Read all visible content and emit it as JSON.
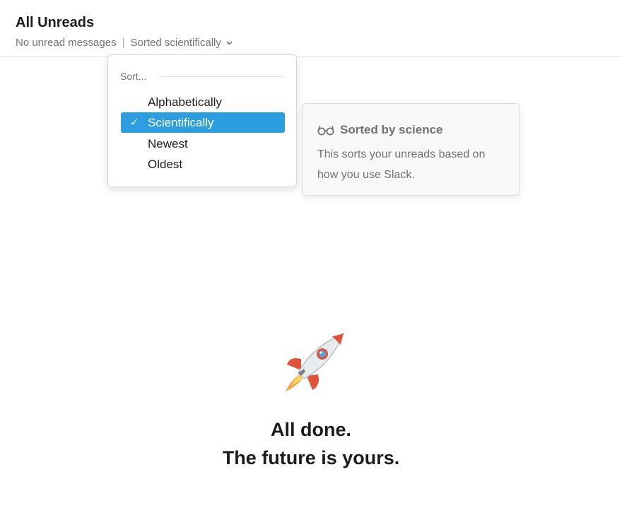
{
  "header": {
    "title": "All Unreads",
    "status": "No unread messages",
    "separator": "|",
    "sort_label": "Sorted scientifically",
    "sort_icon": "chevron-down-icon"
  },
  "sort_menu": {
    "header": "Sort...",
    "items": [
      {
        "label": "Alphabetically",
        "selected": false
      },
      {
        "label": "Scientifically",
        "selected": true,
        "check": "✓"
      },
      {
        "label": "Newest",
        "selected": false
      },
      {
        "label": "Oldest",
        "selected": false
      }
    ],
    "selected_color": "#2c9dde"
  },
  "tooltip": {
    "icon": "glasses-icon",
    "title": "Sorted by science",
    "body": "This sorts your unreads based on how you use Slack."
  },
  "empty_state": {
    "icon": "rocket-icon",
    "line1": "All done.",
    "line2": "The future is yours."
  }
}
